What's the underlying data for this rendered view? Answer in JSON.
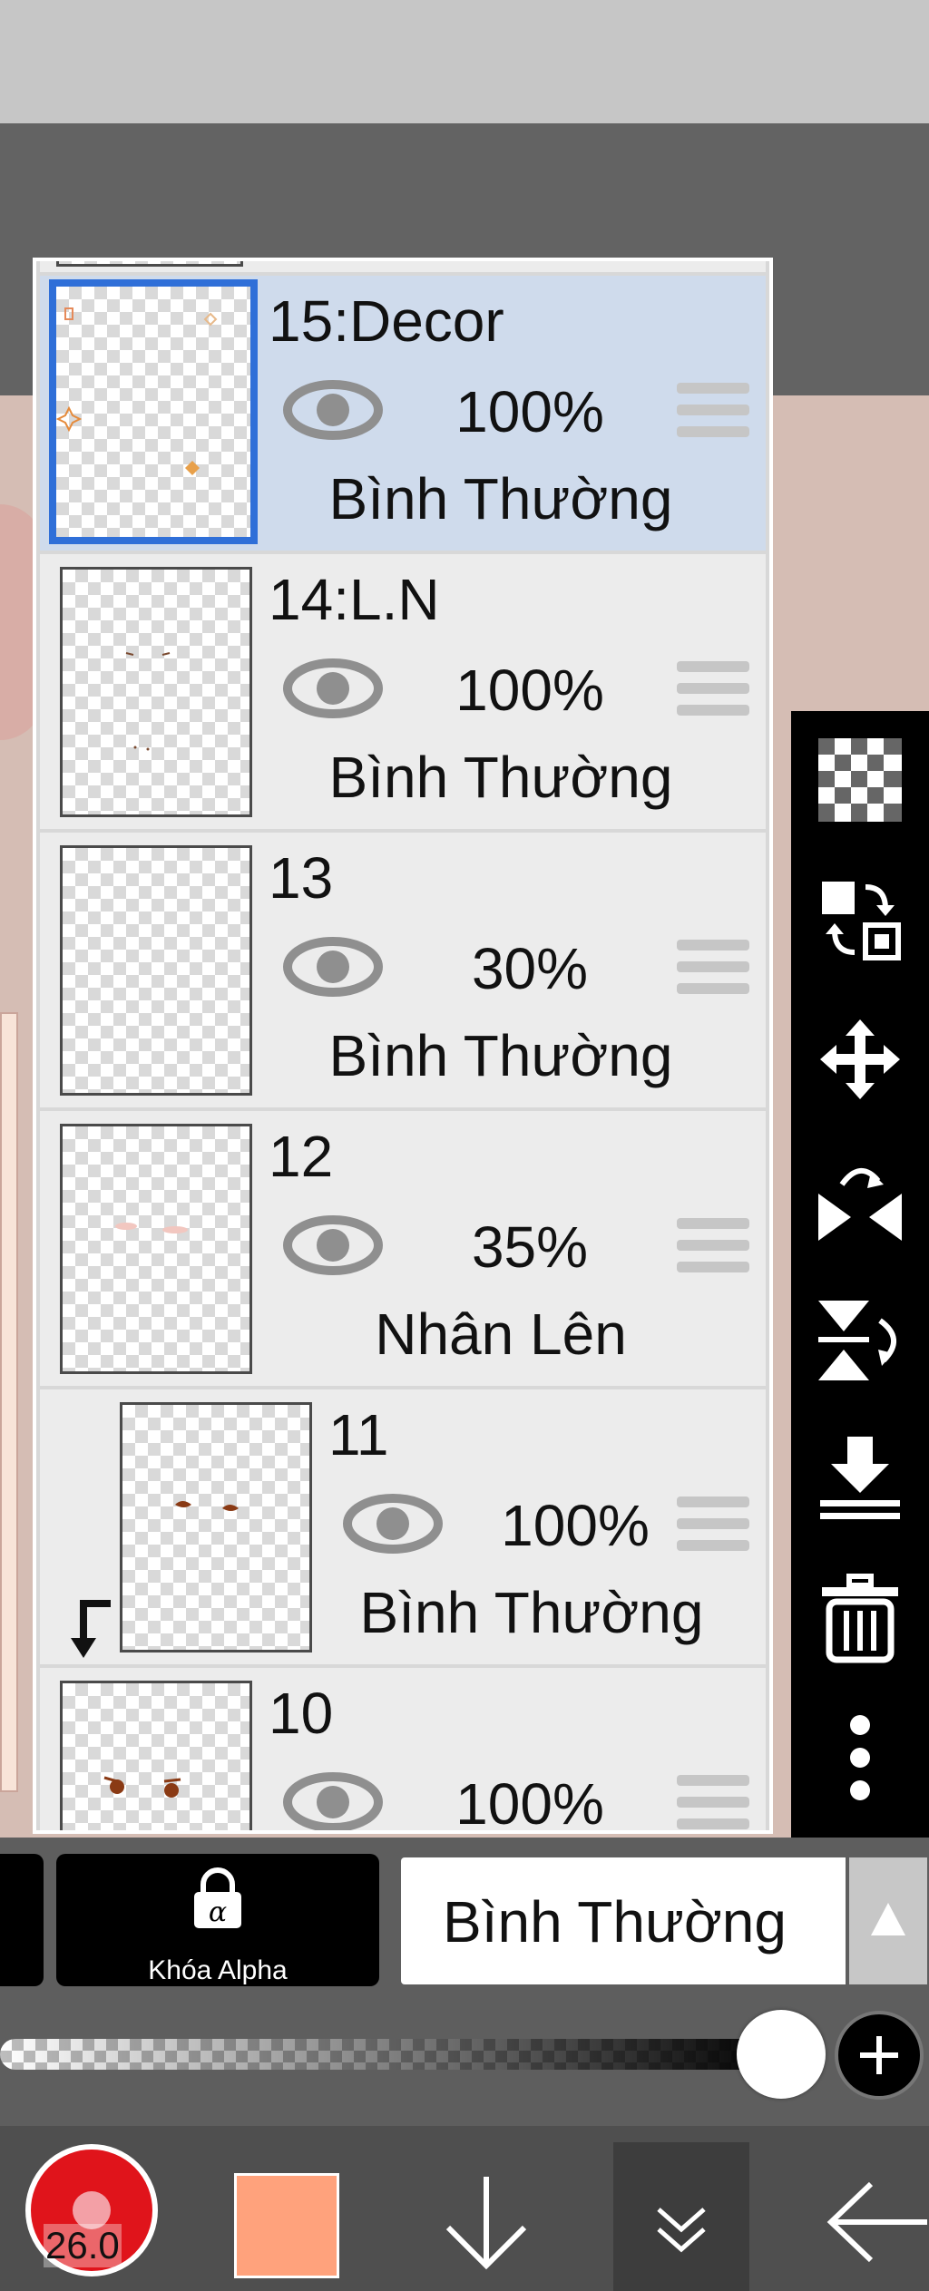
{
  "layers": [
    {
      "id": "15",
      "name": "15:Decor",
      "opacity": "100%",
      "blend": "Bình Thường",
      "selected": true,
      "clipped": false
    },
    {
      "id": "14",
      "name": "14:L.N",
      "opacity": "100%",
      "blend": "Bình Thường",
      "selected": false,
      "clipped": false
    },
    {
      "id": "13",
      "name": "13",
      "opacity": "30%",
      "blend": "Bình Thường",
      "selected": false,
      "clipped": false
    },
    {
      "id": "12",
      "name": "12",
      "opacity": "35%",
      "blend": "Nhân Lên",
      "selected": false,
      "clipped": false
    },
    {
      "id": "11",
      "name": "11",
      "opacity": "100%",
      "blend": "Bình Thường",
      "selected": false,
      "clipped": true
    },
    {
      "id": "10",
      "name": "10",
      "opacity": "100%",
      "blend": "",
      "selected": false,
      "clipped": false
    }
  ],
  "right_toolbar": {
    "icons": [
      "transparency-checker-icon",
      "swap-layers-icon",
      "move-icon",
      "flip-horizontal-icon",
      "flip-vertical-icon",
      "merge-down-icon",
      "trash-icon",
      "more-icon"
    ]
  },
  "bottom_controls": {
    "alpha_lock_label": "Khóa Alpha",
    "blend_mode_value": "Bình Thường",
    "layer_opacity_fraction": 1.0
  },
  "bottom_bar": {
    "brush_size": "26.0",
    "brush_color": "#e0141b",
    "current_color": "#ffa27c"
  },
  "colors": {
    "selected_row": "#cfdbec",
    "selected_border": "#2f6fd8",
    "row_bg": "#ececec"
  }
}
